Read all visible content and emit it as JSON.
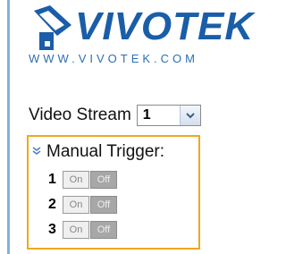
{
  "logo": {
    "brand": "VIVOTEK",
    "url": "WWW.VIVOTEK.COM"
  },
  "video_stream": {
    "label": "Video Stream",
    "value": "1",
    "arrow_icon": "chevron-down-icon"
  },
  "manual_trigger": {
    "label": "Manual Trigger:",
    "rows": [
      {
        "number": "1",
        "on_label": "On",
        "off_label": "Off"
      },
      {
        "number": "2",
        "on_label": "On",
        "off_label": "Off"
      },
      {
        "number": "3",
        "on_label": "On",
        "off_label": "Off"
      }
    ]
  },
  "colors": {
    "accent": "#1a5da8",
    "highlight_border": "#f0a81c",
    "sidebar": "#7fb3dd"
  }
}
